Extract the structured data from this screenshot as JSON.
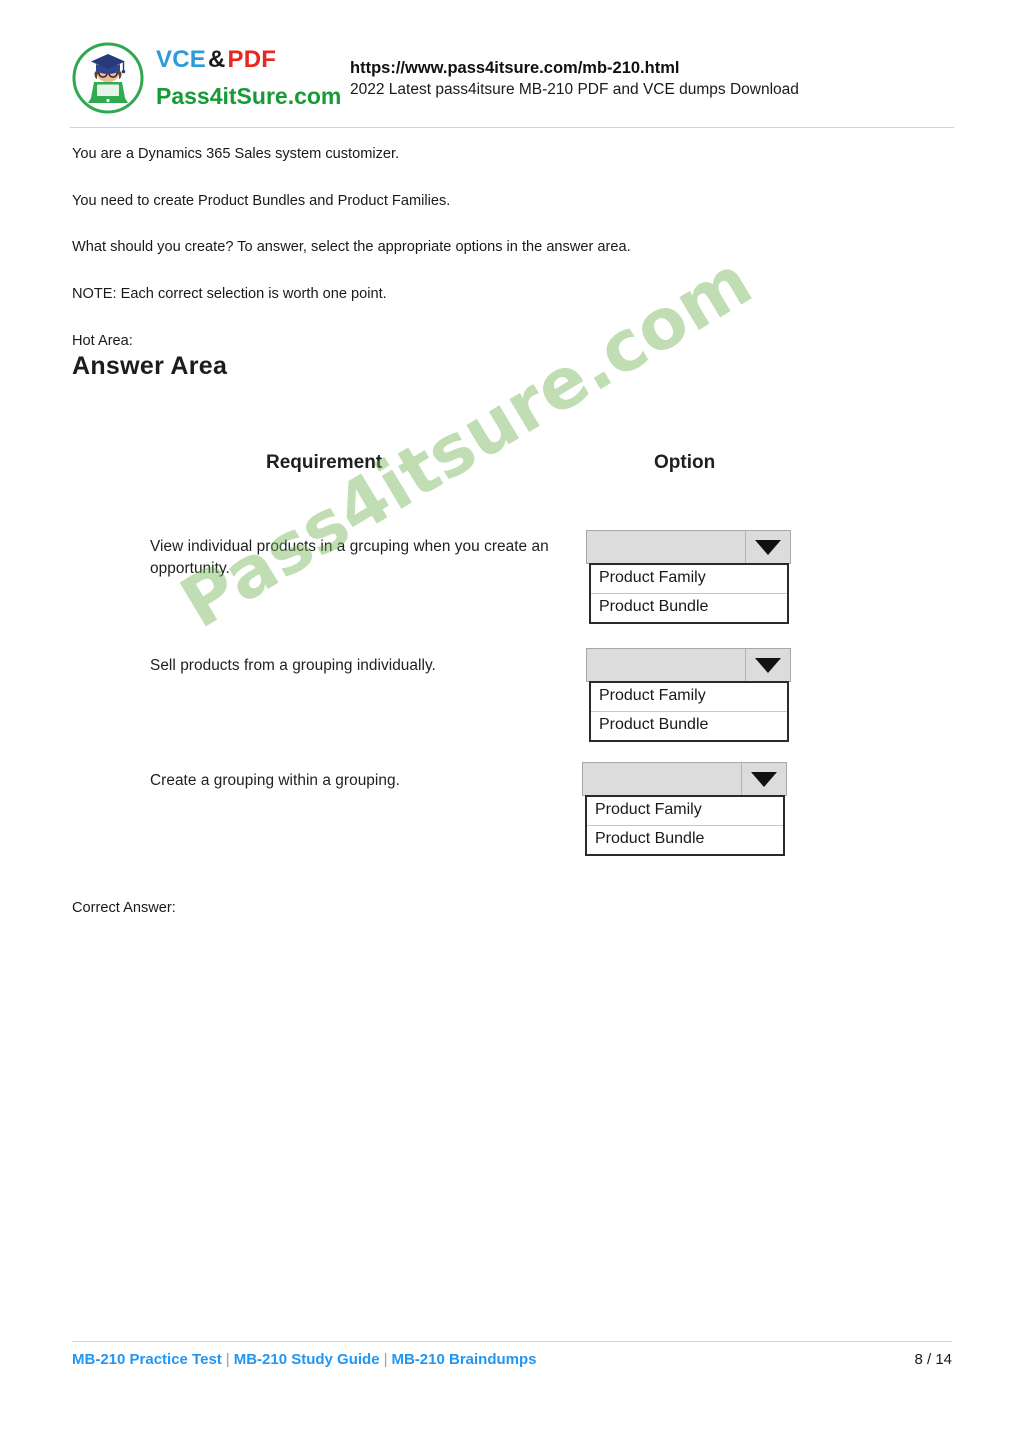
{
  "header": {
    "logo": {
      "icon": "graduate-laptop-logo",
      "vce": "VCE",
      "amp": "&",
      "pdf": "PDF",
      "brand": "Pass4itSure.com",
      "brand_color": "#169b36",
      "vce_color": "#2d9bd8",
      "pdf_color": "#e8281e"
    },
    "url": "https://www.pass4itsure.com/mb-210.html",
    "subtitle": "2022 Latest pass4itsure MB-210 PDF and VCE dumps Download"
  },
  "question": {
    "paragraphs": [
      "You are a Dynamics 365 Sales system customizer.",
      "You need to create Product Bundles and Product Families.",
      "What should you create? To answer, select the appropriate options in the answer area.",
      "NOTE: Each correct selection is worth one point.",
      "Hot Area:"
    ],
    "correct_answer_label": "Correct Answer:"
  },
  "answer_area": {
    "title": "Answer Area",
    "columns": {
      "requirement": "Requirement",
      "option": "Option"
    },
    "watermark": "Pass4itsure.com",
    "watermark_color": "#6ab04c",
    "rows": [
      {
        "requirement": "View individual products in a grcuping when you create an opportunity.",
        "selected": "",
        "options": [
          "Product Family",
          "Product Bundle"
        ]
      },
      {
        "requirement": "Sell products from a grouping individually.",
        "selected": "",
        "options": [
          "Product Family",
          "Product Bundle"
        ]
      },
      {
        "requirement": "Create a grouping within a grouping.",
        "selected": "",
        "options": [
          "Product Family",
          "Product Bundle"
        ]
      }
    ]
  },
  "footer": {
    "links": [
      "MB-210 Practice Test",
      "MB-210 Study Guide",
      "MB-210 Braindumps"
    ],
    "separator": "|",
    "page": "8 / 14",
    "link_color": "#2196f3"
  }
}
